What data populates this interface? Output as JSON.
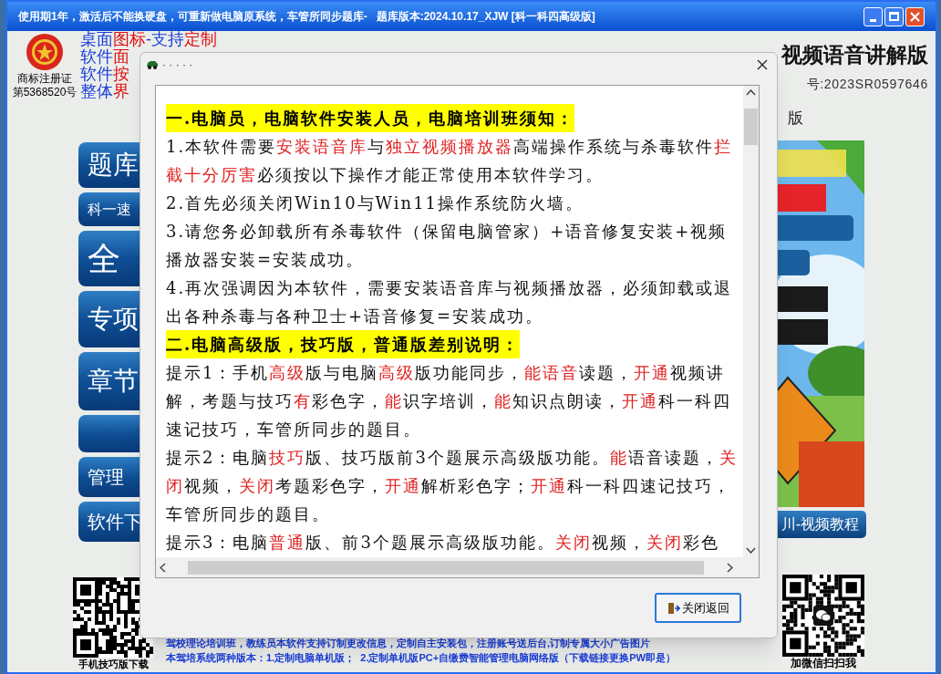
{
  "window": {
    "title": "使用期1年，激活后不能换硬盘，可重新做电脑原系统，车管所同步题库-   题库版本:2024.10.17_XJW [科一科四高级版]"
  },
  "trademark": {
    "caption": "商标注册证",
    "number": "第5368520号"
  },
  "notice_lines": [
    [
      {
        "text": "桌面",
        "emphasis": false
      },
      {
        "text": "图标",
        "emphasis": true
      },
      {
        "text": "-支持",
        "emphasis": false
      },
      {
        "text": "定制",
        "emphasis": true
      }
    ],
    [
      {
        "text": "软件",
        "emphasis": false
      },
      {
        "text": "面",
        "emphasis": true
      }
    ],
    [
      {
        "text": "软件",
        "emphasis": false
      },
      {
        "text": "按",
        "emphasis": true
      }
    ],
    [
      {
        "text": "整体",
        "emphasis": false
      },
      {
        "text": "界",
        "emphasis": true
      }
    ]
  ],
  "heading": "视频语音讲解版",
  "registration": "号:2023SR0597646",
  "edition_fragment": "版",
  "menu_buttons": [
    {
      "kind": "text",
      "label": "题库"
    },
    {
      "kind": "text",
      "label": "科一速"
    },
    {
      "kind": "text",
      "label": "全"
    },
    {
      "kind": "text",
      "label": "专项"
    },
    {
      "kind": "text",
      "label": "章节"
    },
    {
      "kind": "blank"
    },
    {
      "kind": "text",
      "label": "管理"
    },
    {
      "kind": "text",
      "label": "软件下"
    }
  ],
  "video_button": "川-视频教程",
  "dialog": {
    "title": "· · · · ·",
    "paragraphs": [
      {
        "kind": "heading",
        "segments": [
          {
            "text": "一.电脑员，电脑软件安装人员，电脑培训班须知：",
            "emphasis": false
          }
        ]
      },
      {
        "kind": "body",
        "segments": [
          {
            "text": "1.本软件需要",
            "emphasis": false
          },
          {
            "text": "安装语音库",
            "emphasis": true
          },
          {
            "text": "与",
            "emphasis": false
          },
          {
            "text": "独立视频播放器",
            "emphasis": true
          },
          {
            "text": "高端操作系统与杀毒软件",
            "emphasis": false
          },
          {
            "text": "拦截十分厉害",
            "emphasis": true
          },
          {
            "text": "必须按以下操作才能正常使用本软件学习。",
            "emphasis": false
          }
        ]
      },
      {
        "kind": "body",
        "segments": [
          {
            "text": "2.首先必须关闭Win10与Win11操作系统防火墙。",
            "emphasis": false
          }
        ]
      },
      {
        "kind": "body",
        "segments": [
          {
            "text": "3.请您务必卸载所有杀毒软件（保留电脑管家）+语音修复安装+视频播放器安装=安装成功。",
            "emphasis": false
          }
        ]
      },
      {
        "kind": "body",
        "segments": [
          {
            "text": "4.再次强调因为本软件，需要安装语音库与视频播放器，必须卸载或退出各种杀毒与各种卫士+语音修复=安装成功。",
            "emphasis": false
          }
        ]
      },
      {
        "kind": "heading",
        "segments": [
          {
            "text": "二.电脑高级版，技巧版，普通版差别说明：",
            "emphasis": false
          }
        ]
      },
      {
        "kind": "body",
        "segments": [
          {
            "text": "提示1：手机",
            "emphasis": false
          },
          {
            "text": "高级",
            "emphasis": true
          },
          {
            "text": "版与电脑",
            "emphasis": false
          },
          {
            "text": "高级",
            "emphasis": true
          },
          {
            "text": "版功能同步，",
            "emphasis": false
          },
          {
            "text": "能语音",
            "emphasis": true
          },
          {
            "text": "读题，",
            "emphasis": false
          },
          {
            "text": "开通",
            "emphasis": true
          },
          {
            "text": "视频讲解，考题与技巧",
            "emphasis": false
          },
          {
            "text": "有",
            "emphasis": true
          },
          {
            "text": "彩色字，",
            "emphasis": false
          },
          {
            "text": "能",
            "emphasis": true
          },
          {
            "text": "识字培训，",
            "emphasis": false
          },
          {
            "text": "能",
            "emphasis": true
          },
          {
            "text": "知识点朗读，",
            "emphasis": false
          },
          {
            "text": "开通",
            "emphasis": true
          },
          {
            "text": "科一科四速记技巧，车管所同步的题目。",
            "emphasis": false
          }
        ]
      },
      {
        "kind": "body",
        "segments": [
          {
            "text": "提示2：电脑",
            "emphasis": false
          },
          {
            "text": "技巧",
            "emphasis": true
          },
          {
            "text": "版、技巧版前3个题展示高级版功能。",
            "emphasis": false
          },
          {
            "text": "能",
            "emphasis": true
          },
          {
            "text": "语音读题，",
            "emphasis": false
          },
          {
            "text": "关闭",
            "emphasis": true
          },
          {
            "text": "视频，",
            "emphasis": false
          },
          {
            "text": "关闭",
            "emphasis": true
          },
          {
            "text": "考题彩色字，",
            "emphasis": false
          },
          {
            "text": "开通",
            "emphasis": true
          },
          {
            "text": "解析彩色字；",
            "emphasis": false
          },
          {
            "text": "开通",
            "emphasis": true
          },
          {
            "text": "科一科四速记技巧，车管所同步的题目。",
            "emphasis": false
          }
        ]
      },
      {
        "kind": "body",
        "segments": [
          {
            "text": "提示3：电脑",
            "emphasis": false
          },
          {
            "text": "普通",
            "emphasis": true
          },
          {
            "text": "版、前3个题展示高级版功能。",
            "emphasis": false
          },
          {
            "text": "关闭",
            "emphasis": true
          },
          {
            "text": "视频，",
            "emphasis": false
          },
          {
            "text": "关闭",
            "emphasis": true
          },
          {
            "text": "彩色",
            "emphasis": false
          }
        ]
      }
    ],
    "close_button": "关闭返回"
  },
  "qr_left_caption": "手机技巧版下载",
  "qr_right_caption": "加微信扫扫我",
  "footer_lines": [
    "驾校理论培训班，教练员本软件支持订制更改信息，定制自主安装包，注册账号送后台,订制专属大小广告图片",
    "本驾培系统两种版本：1.定制电脑单机版；  2.定制单机版PC+自缴费智能管理电脑网络版（下载链接更换PW即是）"
  ]
}
